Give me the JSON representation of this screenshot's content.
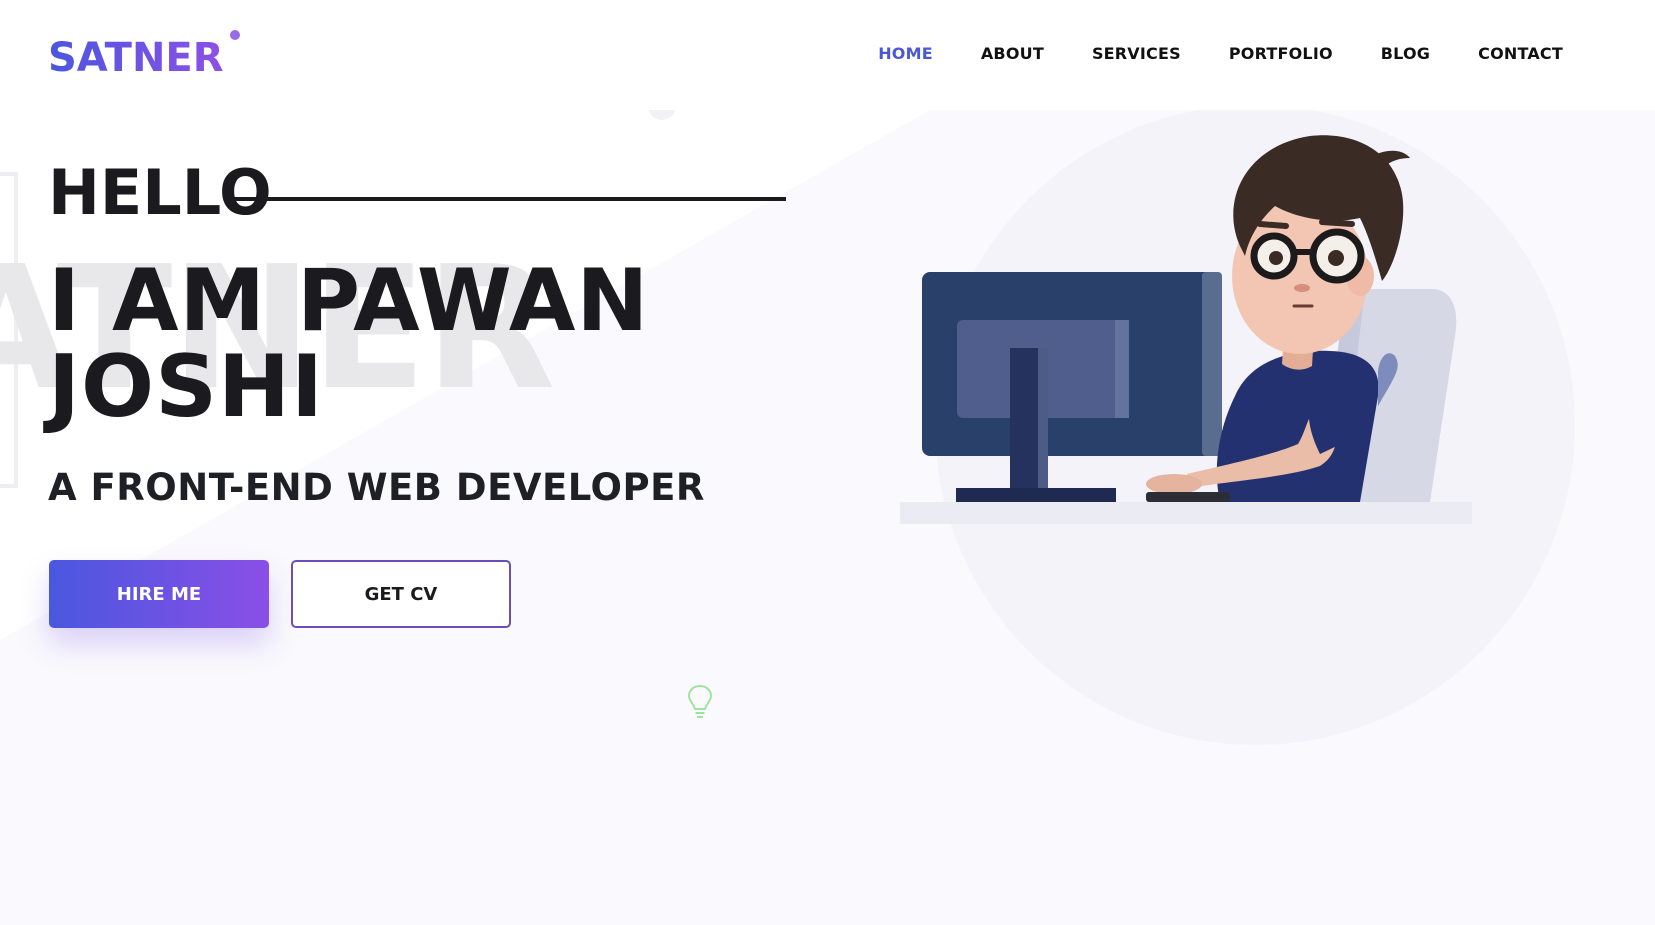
{
  "logo": {
    "text": "SATNER"
  },
  "nav": {
    "items": [
      {
        "label": "HOME",
        "active": true
      },
      {
        "label": "ABOUT",
        "active": false
      },
      {
        "label": "SERVICES",
        "active": false
      },
      {
        "label": "PORTFOLIO",
        "active": false
      },
      {
        "label": "BLOG",
        "active": false
      },
      {
        "label": "CONTACT",
        "active": false
      }
    ]
  },
  "hero": {
    "watermark": "ATNER",
    "greeting": "HELLO",
    "name_line1": "I AM PAWAN",
    "name_line2": "JOSHI",
    "role": "A FRONT-END WEB DEVELOPER",
    "hire_button": "HIRE ME",
    "cv_button": "GET CV"
  },
  "icons": {
    "bulb": "lightbulb-icon",
    "illustration": "developer-at-computer-illustration"
  },
  "colors": {
    "accent_start": "#4a57df",
    "accent_end": "#8e4fe8",
    "nav_active": "#4a58d8",
    "text_dark": "#1b1b1f",
    "hero_tint": "#faf9fd",
    "watermark": "#e8e8ea",
    "bulb_stroke": "#9fe3a1"
  }
}
